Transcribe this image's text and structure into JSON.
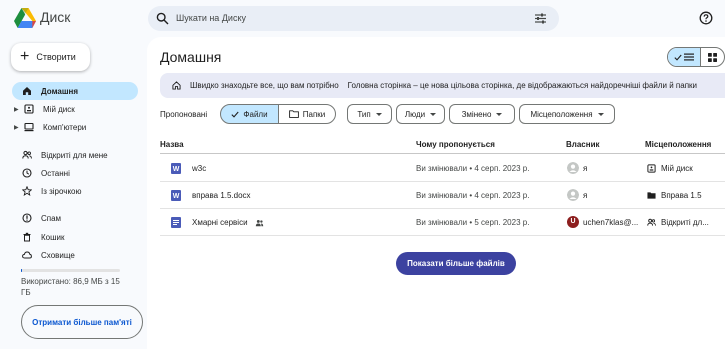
{
  "app": {
    "title": "Диск"
  },
  "search": {
    "placeholder": "Шукати на Диску"
  },
  "sidebar": {
    "create_label": "Створити",
    "items": [
      {
        "label": "Домашня",
        "icon": "home-icon",
        "active": true
      },
      {
        "label": "Мій диск",
        "icon": "my-drive-icon",
        "expandable": true
      },
      {
        "label": "Комп'ютери",
        "icon": "computer-icon",
        "expandable": true
      },
      {
        "label": "Відкриті для мене",
        "icon": "shared-people-icon"
      },
      {
        "label": "Останні",
        "icon": "clock-icon"
      },
      {
        "label": "Із зірочкою",
        "icon": "star-icon"
      },
      {
        "label": "Спам",
        "icon": "spam-icon"
      },
      {
        "label": "Кошик",
        "icon": "trash-icon"
      },
      {
        "label": "Сховище",
        "icon": "cloud-icon"
      }
    ],
    "storage_text": "Використано: 86,9 МБ з 15 ГБ",
    "storage_used_fraction": 0.006,
    "more_storage_label": "Отримати більше пам'яті"
  },
  "main": {
    "title": "Домашня",
    "banner": {
      "strong": "Швидко знаходьте все, що вам потрібно",
      "text": "Головна сторінка – це нова цільова сторінка, де відображаються найдоречніші файли й папки"
    },
    "suggested_label": "Пропоновані",
    "segments": {
      "files": "Файли",
      "folders": "Папки"
    },
    "filters": {
      "type": "Тип",
      "people": "Люди",
      "modified": "Змінено",
      "location": "Місцеположення"
    },
    "columns": {
      "name": "Назва",
      "reason": "Чому пропонується",
      "owner": "Власник",
      "location": "Місцеположення"
    },
    "rows": [
      {
        "name": "w3c",
        "icon": "word-doc-icon",
        "reason": "Ви змінювали • 4 серп. 2023 р.",
        "owner": "я",
        "owner_avatar": "default-avatar",
        "location": "Мій диск",
        "location_icon": "my-drive-icon"
      },
      {
        "name": "вправа 1.5.docx",
        "icon": "word-doc-icon",
        "reason": "Ви змінювали • 4 серп. 2023 р.",
        "owner": "я",
        "owner_avatar": "default-avatar",
        "location": "Вправа 1.5",
        "location_icon": "folder-icon"
      },
      {
        "name": "Хмарні сервіси",
        "icon": "google-doc-icon",
        "shared": true,
        "reason": "Ви змінювали • 5 серп. 2023 р.",
        "owner": "uchen7klas@...",
        "owner_avatar": "U",
        "location": "Відкриті дл...",
        "location_icon": "shared-people-icon"
      }
    ],
    "show_more_label": "Показати більше файлів"
  },
  "colors": {
    "accent": "#0b57d0",
    "active_bg": "#c2e7ff",
    "banner_bg": "#e8eaf6",
    "button_bg": "#3c42a0",
    "avatar_u": "#8d1f1f"
  }
}
